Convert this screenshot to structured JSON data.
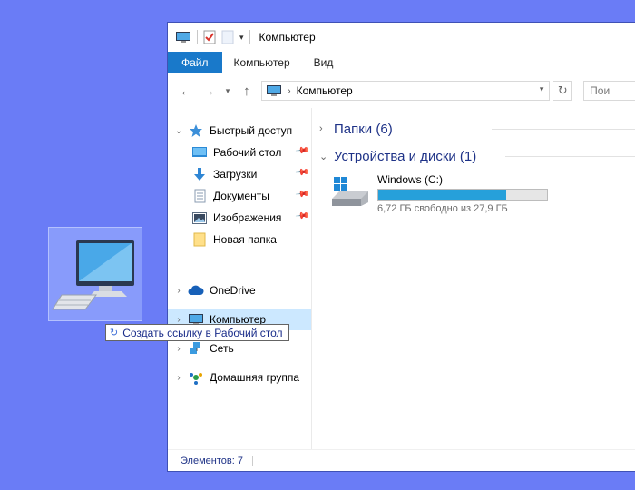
{
  "tooltip": {
    "text": "Создать ссылку в Рабочий стол",
    "icon": "shortcut-arrow-icon"
  },
  "window": {
    "title": "Компьютер",
    "ribbon_tabs": [
      "Файл",
      "Компьютер",
      "Вид"
    ],
    "address": {
      "path": "Компьютер"
    },
    "search_placeholder": "Пои"
  },
  "nav": {
    "quick_access": "Быстрый доступ",
    "quick_items": [
      "Рабочий стол",
      "Загрузки",
      "Документы",
      "Изображения",
      "Новая папка"
    ],
    "onedrive": "OneDrive",
    "computer": "Компьютер",
    "network": "Сеть",
    "homegroup": "Домашняя группа"
  },
  "content": {
    "folders_header": "Папки (6)",
    "devices_header": "Устройства и диски (1)",
    "drive": {
      "name": "Windows (C:)",
      "free_text": "6,72 ГБ свободно из 27,9 ГБ",
      "used_fraction": 0.76
    }
  },
  "status": {
    "items": "Элементов: 7"
  },
  "colors": {
    "desktop": "#6a7cf6",
    "accent": "#1979ca",
    "selection": "#cce8ff",
    "bar": "#26a0da",
    "header_text": "#1e3287"
  }
}
